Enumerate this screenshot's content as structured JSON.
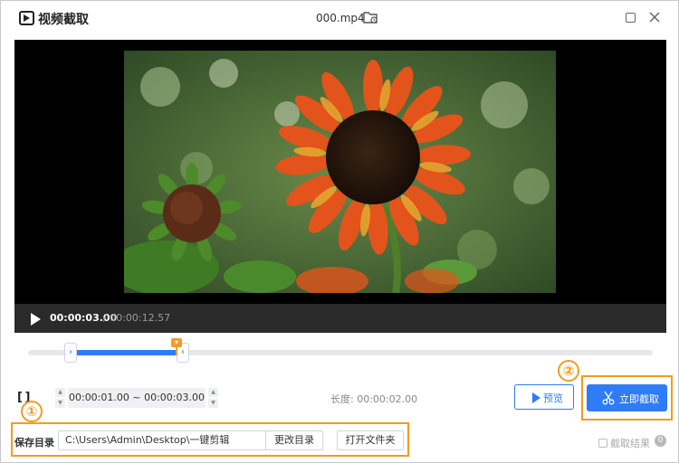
{
  "window": {
    "app_title": "视频截取",
    "file_name": "000.mp4"
  },
  "player": {
    "current_time": "00:00:03.00",
    "total_time": "/ 00:00:12.57"
  },
  "timeline": {
    "selection_start_fraction": 0.07,
    "selection_end_fraction": 0.25,
    "playhead_fraction": 0.24
  },
  "range": {
    "value": "00:00:01.00 ~ 00:00:03.00",
    "length_text": "长度: 00:00:02.00"
  },
  "actions": {
    "preview_label": "预览",
    "clip_label": "立即截取"
  },
  "annotations": {
    "badge_1": "①",
    "badge_2": "②",
    "highlight_color": "#f39b22"
  },
  "save": {
    "label": "保存目录",
    "path": "C:\\Users\\Admin\\Desktop\\一键剪辑",
    "change_dir_label": "更改目录",
    "open_folder_label": "打开文件夹"
  },
  "results": {
    "label": "截取结果",
    "count": "0"
  },
  "colors": {
    "accent": "#2f7cf6",
    "player_bar": "#2a2a2a"
  },
  "icons": {
    "app": "video-clip-icon",
    "folder": "folder-open-icon",
    "maximize": "maximize-icon",
    "close": "close-icon",
    "play": "play-icon",
    "bracket": "range-bracket-icon",
    "scissors": "scissors-icon"
  }
}
